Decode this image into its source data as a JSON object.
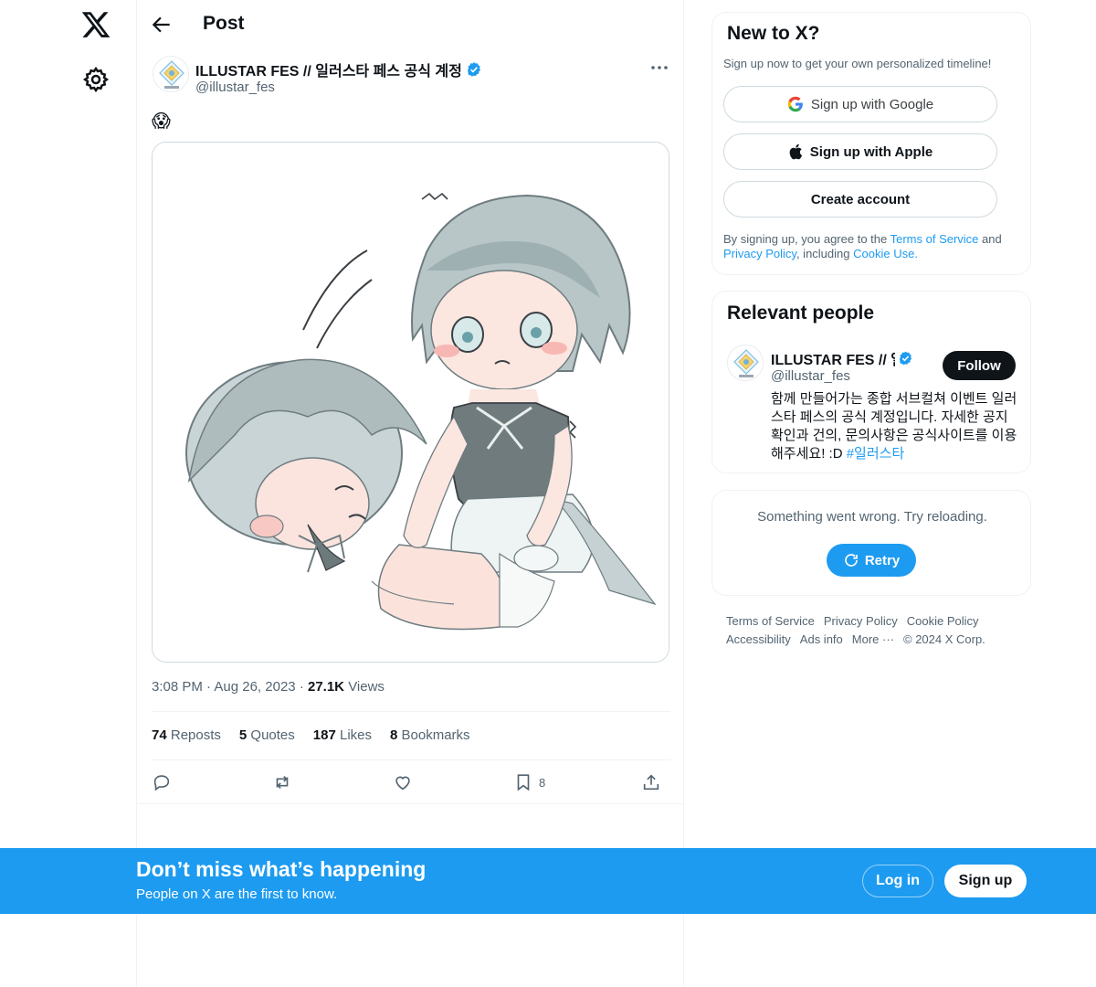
{
  "nav": {
    "logo_icon": "x-logo-icon",
    "settings_icon": "gear-icon"
  },
  "header": {
    "title": "Post",
    "back_icon": "arrow-left-icon"
  },
  "post": {
    "author_name": "ILLUSTAR FES // 일러스타 페스 공식 계정",
    "author_handle": "@illustar_fes",
    "text": "😱",
    "time": "3:08 PM",
    "date": "Aug 26, 2023",
    "views_count": "27.1K",
    "views_label": "Views",
    "stats": {
      "reposts_count": "74",
      "reposts_label": "Reposts",
      "quotes_count": "5",
      "quotes_label": "Quotes",
      "likes_count": "187",
      "likes_label": "Likes",
      "bookmarks_count": "8",
      "bookmarks_label": "Bookmarks"
    },
    "bookmark_action_count": "8"
  },
  "sidebar": {
    "newx": {
      "title": "New to X?",
      "subtitle": "Sign up now to get your own personalized timeline!",
      "google_label": "Sign up with Google",
      "apple_label": "Sign up with Apple",
      "create_label": "Create account",
      "terms_prefix": "By signing up, you agree to the ",
      "terms_link": "Terms of Service",
      "terms_and": " and ",
      "privacy_link": "Privacy Policy",
      "terms_including": ", including ",
      "cookie_link": "Cookie Use",
      "terms_end": "."
    },
    "people": {
      "title": "Relevant people",
      "name": "ILLUSTAR FES // 일러스타 페스 공식 계정",
      "handle": "@illustar_fes",
      "follow_label": "Follow",
      "bio": "함께 만들어가는 종합 서브컬쳐 이벤트 일러스타 페스의 공식 계정입니다. 자세한 공지 확인과 건의, 문의사항은 공식사이트를 이용해주세요! :D ",
      "bio_hashtag": "#일러스타"
    },
    "error": {
      "message": "Something went wrong. Try reloading.",
      "retry_label": "Retry"
    },
    "footer": {
      "terms": "Terms of Service",
      "privacy": "Privacy Policy",
      "cookie": "Cookie Policy",
      "accessibility": "Accessibility",
      "ads": "Ads info",
      "more": "More ···",
      "copyright": "© 2024 X Corp."
    }
  },
  "banner": {
    "title": "Don’t miss what’s happening",
    "subtitle": "People on X are the first to know.",
    "login_label": "Log in",
    "signup_label": "Sign up"
  },
  "colors": {
    "accent": "#1d9bf0",
    "text": "#0f1419",
    "muted": "#536471",
    "border": "#eff3f4"
  }
}
